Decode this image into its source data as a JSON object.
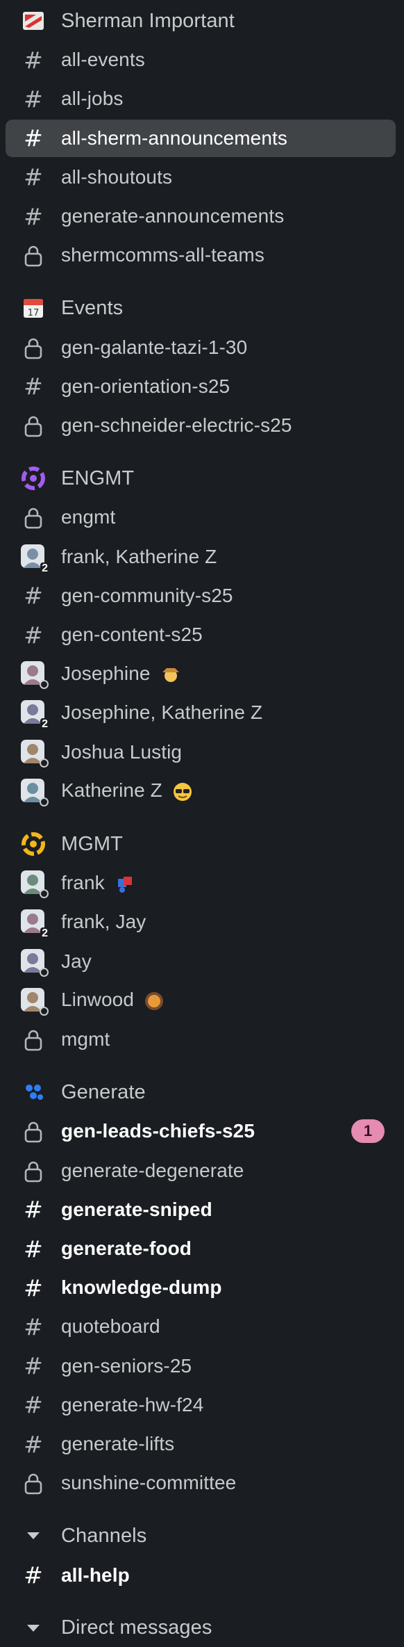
{
  "sections": [
    {
      "header": {
        "label": "Sherman Important",
        "icon": "sherman-flag-icon"
      },
      "items": [
        {
          "label": "all-events",
          "kind": "channel"
        },
        {
          "label": "all-jobs",
          "kind": "channel"
        },
        {
          "label": "all-sherm-announcements",
          "kind": "channel",
          "active": true
        },
        {
          "label": "all-shoutouts",
          "kind": "channel"
        },
        {
          "label": "generate-announcements",
          "kind": "channel"
        },
        {
          "label": "shermcomms-all-teams",
          "kind": "private"
        }
      ]
    },
    {
      "header": {
        "label": "Events",
        "icon": "calendar-icon"
      },
      "items": [
        {
          "label": "gen-galante-tazi-1-30",
          "kind": "private"
        },
        {
          "label": "gen-orientation-s25",
          "kind": "channel"
        },
        {
          "label": "gen-schneider-electric-s25",
          "kind": "private"
        }
      ]
    },
    {
      "header": {
        "label": "ENGMT",
        "icon": "engmt-logo-icon"
      },
      "items": [
        {
          "label": "engmt",
          "kind": "private"
        },
        {
          "label": "frank, Katherine Z",
          "kind": "group-dm",
          "count": "2"
        },
        {
          "label": "gen-community-s25",
          "kind": "channel"
        },
        {
          "label": "gen-content-s25",
          "kind": "channel"
        },
        {
          "label": "Josephine",
          "kind": "dm",
          "emoji": "farmer-emoji"
        },
        {
          "label": "Josephine, Katherine Z",
          "kind": "group-dm",
          "count": "2"
        },
        {
          "label": "Joshua Lustig",
          "kind": "dm"
        },
        {
          "label": "Katherine Z",
          "kind": "dm",
          "emoji": "sunglasses-emoji"
        }
      ]
    },
    {
      "header": {
        "label": "MGMT",
        "icon": "mgmt-logo-icon"
      },
      "items": [
        {
          "label": "frank",
          "kind": "dm",
          "emoji": "puzzle-emoji"
        },
        {
          "label": "frank, Jay",
          "kind": "group-dm",
          "count": "2"
        },
        {
          "label": "Jay",
          "kind": "dm"
        },
        {
          "label": "Linwood",
          "kind": "dm",
          "emoji": "round-badge-emoji"
        },
        {
          "label": "mgmt",
          "kind": "private"
        }
      ]
    },
    {
      "header": {
        "label": "Generate",
        "icon": "generate-logo-icon"
      },
      "items": [
        {
          "label": "gen-leads-chiefs-s25",
          "kind": "private",
          "unread": true,
          "badge": "1"
        },
        {
          "label": "generate-degenerate",
          "kind": "private"
        },
        {
          "label": "generate-sniped",
          "kind": "channel",
          "unread": true
        },
        {
          "label": "generate-food",
          "kind": "channel",
          "unread": true
        },
        {
          "label": "knowledge-dump",
          "kind": "channel",
          "unread": true
        },
        {
          "label": "quoteboard",
          "kind": "channel"
        },
        {
          "label": "gen-seniors-25",
          "kind": "channel"
        },
        {
          "label": "generate-hw-f24",
          "kind": "channel"
        },
        {
          "label": "generate-lifts",
          "kind": "channel"
        },
        {
          "label": "sunshine-committee",
          "kind": "private"
        }
      ]
    },
    {
      "header": {
        "label": "Channels",
        "icon": "caret-down-icon"
      },
      "items": [
        {
          "label": "all-help",
          "kind": "channel",
          "unread": true
        }
      ]
    },
    {
      "header": {
        "label": "Direct messages",
        "icon": "caret-down-icon"
      },
      "items": []
    }
  ],
  "colors": {
    "background": "#1a1d21",
    "active_row": "#414447",
    "badge": "#e68bb2",
    "text": "#c9cacc",
    "unread_text": "#ffffff"
  }
}
